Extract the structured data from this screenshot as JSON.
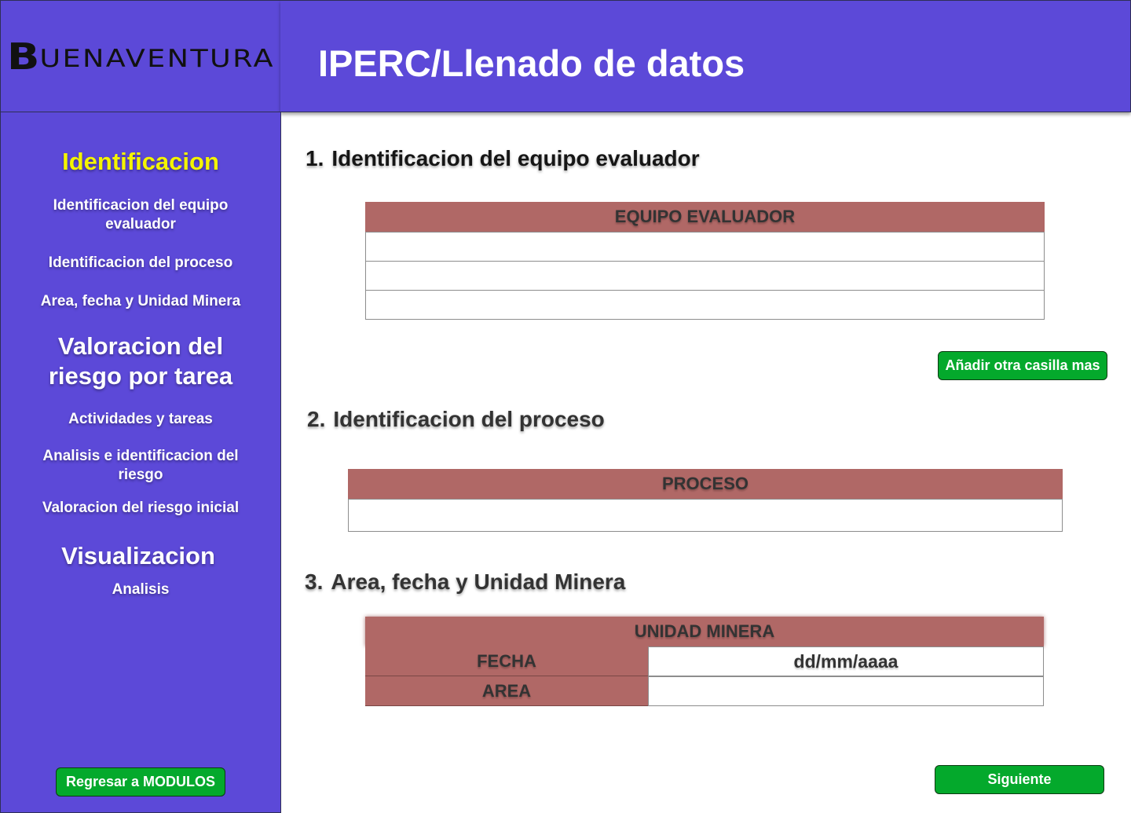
{
  "brand": {
    "logo_initial": "B",
    "logo_rest": "UENAVENTURA"
  },
  "header": {
    "title": "IPERC/Llenado de datos"
  },
  "sidebar": {
    "identificacion": {
      "heading": "Identificacion",
      "items": [
        "Identificacion del equipo evaluador",
        "Identificacion del proceso",
        "Area, fecha y Unidad Minera"
      ]
    },
    "valoracion": {
      "heading_line1": "Valoracion del",
      "heading_line2": "riesgo por tarea",
      "items": [
        "Actividades y tareas",
        "Analisis e identificacion del riesgo",
        "Valoracion del riesgo inicial"
      ]
    },
    "visualizacion": {
      "heading": "Visualizacion",
      "items": [
        "Analisis"
      ]
    },
    "back_button": "Regresar a MODULOS"
  },
  "main": {
    "section1": {
      "number": "1.",
      "title": "Identificacion del equipo evaluador",
      "table_header": "EQUIPO EVALUADOR",
      "add_button": "Añadir otra casilla mas"
    },
    "section2": {
      "number": "2.",
      "title": "Identificacion del proceso",
      "table_header": "PROCESO"
    },
    "section3": {
      "number": "3.",
      "title": "Area, fecha y Unidad Minera",
      "table_header": "UNIDAD MINERA",
      "fecha_label": "FECHA",
      "fecha_value": "dd/mm/aaaa",
      "area_label": "AREA",
      "area_value": ""
    },
    "next_button": "Siguiente"
  }
}
